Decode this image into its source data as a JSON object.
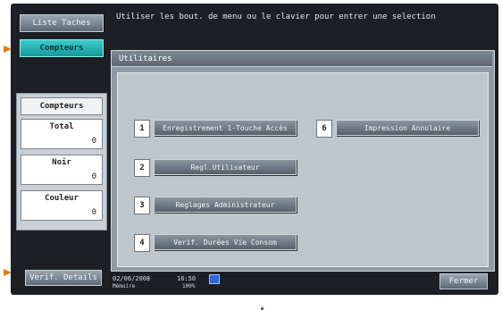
{
  "left": {
    "liste_taches": "Liste Taches",
    "compteurs_tab": "Compteurs",
    "counters_heading": "Compteurs",
    "counters": [
      {
        "label": "Total",
        "value": "0"
      },
      {
        "label": "Noir",
        "value": "0"
      },
      {
        "label": "Couleur",
        "value": "0"
      }
    ],
    "verif_details": "Verif. Details"
  },
  "message": "Utiliser les bout. de menu ou le clavier pour entrer une selection",
  "panel": {
    "title": "Utilitaires",
    "items": [
      {
        "number": "1",
        "label": "Enregistrement 1-Touche Accès"
      },
      {
        "number": "2",
        "label": "Regl.Utilisateur"
      },
      {
        "number": "3",
        "label": "Reglages Administrateur"
      },
      {
        "number": "4",
        "label": "Verif. Durées Vie Consom"
      },
      {
        "number": "6",
        "label": "Impression Annulaire"
      }
    ]
  },
  "footer": {
    "date": "02/06/2008",
    "time": "16:50",
    "memory_label": "Mémoire",
    "memory_value": "100%",
    "fermer": "Fermer"
  },
  "colors": {
    "accent": "#16999c",
    "arrow": "#e07a14"
  }
}
